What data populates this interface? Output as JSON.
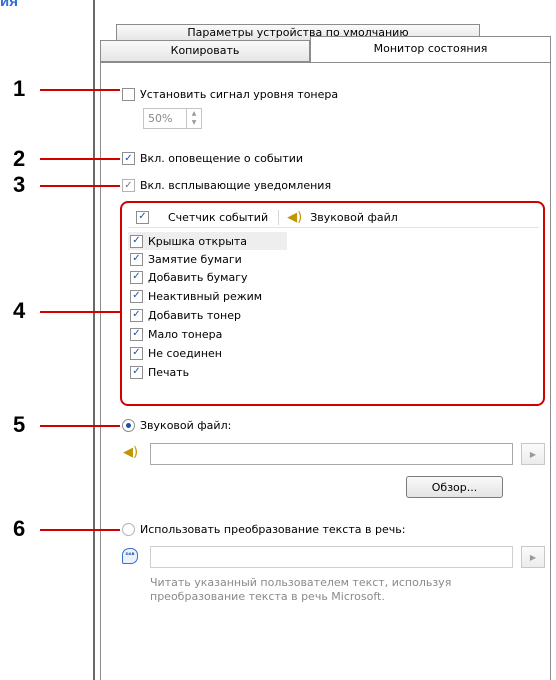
{
  "header_fragment": "ия",
  "tabs": {
    "defaults": "Параметры устройства по умолчанию",
    "copy": "Копировать",
    "monitor": "Монитор состояния"
  },
  "markers": [
    "1",
    "2",
    "3",
    "4",
    "5",
    "6"
  ],
  "toner_alert": {
    "label": "Установить сигнал уровня тонера",
    "checked": false,
    "value": "50%"
  },
  "event_notify": {
    "label": "Вкл. оповещение о событии",
    "checked": true
  },
  "popup_notify": {
    "label": "Вкл. всплывающие уведомления",
    "checked": true
  },
  "events_list": {
    "col_event": "Счетчик событий",
    "col_sound": "Звуковой файл",
    "items": [
      {
        "label": "Крышка открыта",
        "checked": true,
        "selected": true
      },
      {
        "label": "Замятие бумаги",
        "checked": true
      },
      {
        "label": "Добавить бумагу",
        "checked": true
      },
      {
        "label": "Неактивный режим",
        "checked": true
      },
      {
        "label": "Добавить тонер",
        "checked": true
      },
      {
        "label": "Мало тонера",
        "checked": true
      },
      {
        "label": "Не соединен",
        "checked": true
      },
      {
        "label": "Печать",
        "checked": true
      }
    ]
  },
  "sound_file": {
    "label": "Звуковой файл:",
    "selected": true,
    "value": "",
    "browse": "Обзор..."
  },
  "tts": {
    "label": "Использовать преобразование текста в речь:",
    "selected": false,
    "value": "",
    "note": "Читать указанный пользователем текст, используя преобразование текста в речь Microsoft."
  },
  "icons": {
    "speaker": "speaker-icon",
    "tts": "text-to-speech-icon",
    "play": "play-icon"
  },
  "colors": {
    "callout": "#d40000",
    "checkbox_mark": "#1f4fa8",
    "disabled_text": "#8a8a8a"
  }
}
